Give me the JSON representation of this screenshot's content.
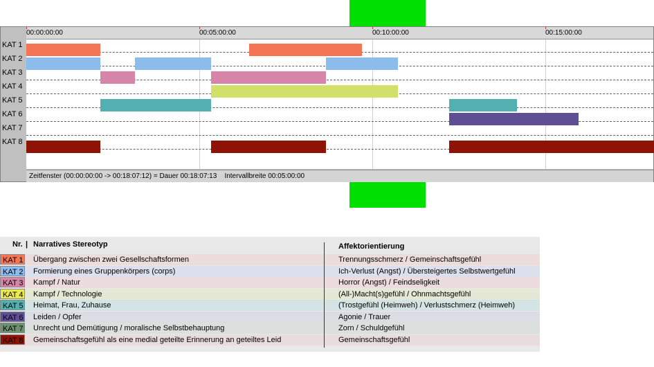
{
  "timeline": {
    "rows": [
      {
        "label": "KAT 1",
        "color": "#f47456",
        "segments": [
          [
            0,
            3.5
          ],
          [
            10.5,
            15.8
          ]
        ]
      },
      {
        "label": "KAT 2",
        "color": "#8cbcec",
        "segments": [
          [
            0,
            3.5
          ],
          [
            5.1,
            8.7
          ],
          [
            14.1,
            17.5
          ]
        ]
      },
      {
        "label": "KAT 3",
        "color": "#d684a8",
        "segments": [
          [
            3.5,
            5.1
          ],
          [
            8.7,
            14.1
          ]
        ]
      },
      {
        "label": "KAT 4",
        "color": "#d0e068",
        "segments": [
          [
            8.7,
            17.5
          ]
        ]
      },
      {
        "label": "KAT 5",
        "color": "#52b0b0",
        "segments": [
          [
            3.5,
            8.7
          ],
          [
            19.9,
            23.1
          ]
        ]
      },
      {
        "label": "KAT 6",
        "color": "#5e4e94",
        "segments": [
          [
            19.9,
            26
          ]
        ]
      },
      {
        "label": "KAT 7",
        "color": "#6e9070",
        "segments": []
      },
      {
        "label": "KAT 8",
        "color": "#8e1206",
        "segments": [
          [
            0,
            3.5
          ],
          [
            8.7,
            14.1
          ],
          [
            19.9,
            33
          ]
        ]
      }
    ],
    "ticks": [
      "00:00:00:00",
      "00:05:00:00",
      "00:10:00:00",
      "00:15:00:00"
    ],
    "status_window": "Zeitfenster (00:00:00:00 -> 00:18:07:12) = Dauer 00:18:07:13",
    "status_interval": "Intervallbreite 00:05:00:00"
  },
  "legend": {
    "header_nr": "Nr.",
    "header_stereotyp": "Narratives Stereotyp",
    "header_affekt": "Affektorientierung",
    "rows": [
      {
        "kat": "KAT 1",
        "color": "#f47456",
        "bg": "#ecdcdc",
        "stereotyp": "Übergang zwischen zwei Gesellschaftsformen",
        "affekt": "Trennungsschmerz / Gemeinschaftsgefühl"
      },
      {
        "kat": "KAT 2",
        "color": "#8cbcec",
        "bg": "#dce0ec",
        "stereotyp": "Formierung eines Gruppenkörpers (corps)",
        "affekt": "Ich-Verlust (Angst) / Übersteigertes Selbstwertgefühl"
      },
      {
        "kat": "KAT 3",
        "color": "#d684a8",
        "bg": "#ecdce0",
        "stereotyp": "Kampf / Natur",
        "affekt": "Horror (Angst) / Feindseligkeit"
      },
      {
        "kat": "KAT 4",
        "color": "#e8e850",
        "bg": "#e4e8d4",
        "stereotyp": "Kampf / Technologie",
        "affekt": "(All-)Macht(s)gefühl / Ohnmachtsgefühl"
      },
      {
        "kat": "KAT 5",
        "color": "#52b0b0",
        "bg": "#d4e4e4",
        "stereotyp": "Heimat, Frau, Zuhause",
        "affekt": "(Trostgefühl (Heimweh) / Verlustschmerz (Heimweh)"
      },
      {
        "kat": "KAT 6",
        "color": "#5e4e94",
        "bg": "#dcdce4",
        "stereotyp": "Leiden / Opfer",
        "affekt": "Agonie / Trauer"
      },
      {
        "kat": "KAT 7",
        "color": "#6e9070",
        "bg": "#dce0dc",
        "stereotyp": "Unrecht und Demütigung / moralische Selbstbehauptung",
        "affekt": "Zorn / Schuldgefühl"
      },
      {
        "kat": "KAT 8",
        "color": "#8e1206",
        "bg": "#e8dcdc",
        "stereotyp": "Gemeinschaftsgefühl als eine medial geteilte Erinnerung an geteiltes Leid",
        "affekt": "Gemeinschaftsgefühl"
      }
    ]
  }
}
